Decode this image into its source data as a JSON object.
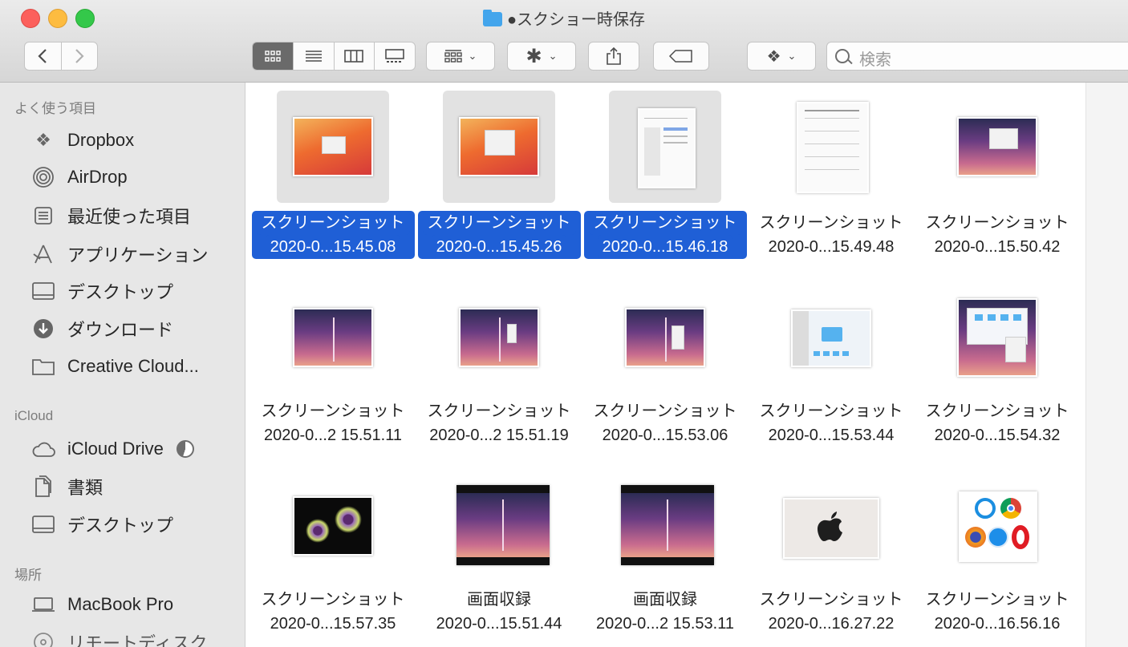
{
  "window": {
    "title": "●スクショー時保存"
  },
  "toolbar": {
    "search_placeholder": "検索"
  },
  "sidebar": {
    "favorites_header": "よく使う項目",
    "favorites": [
      {
        "label": "Dropbox",
        "icon": "dropbox-icon"
      },
      {
        "label": "AirDrop",
        "icon": "airdrop-icon"
      },
      {
        "label": "最近使った項目",
        "icon": "recents-icon"
      },
      {
        "label": "アプリケーション",
        "icon": "applications-icon"
      },
      {
        "label": "デスクトップ",
        "icon": "desktop-icon"
      },
      {
        "label": "ダウンロード",
        "icon": "downloads-icon"
      },
      {
        "label": "Creative Cloud...",
        "icon": "folder-icon"
      }
    ],
    "icloud_header": "iCloud",
    "icloud": [
      {
        "label": "iCloud Drive",
        "icon": "cloud-icon"
      },
      {
        "label": "書類",
        "icon": "documents-icon"
      },
      {
        "label": "デスクトップ",
        "icon": "desktop-icon"
      }
    ],
    "locations_header": "場所",
    "locations": [
      {
        "label": "MacBook Pro",
        "icon": "laptop-icon"
      },
      {
        "label": "リモートディスク",
        "icon": "disc-icon"
      }
    ]
  },
  "files": [
    {
      "name": "スクリーンショット",
      "date": "2020-0...15.45.08",
      "selected": true,
      "thumb": "orange"
    },
    {
      "name": "スクリーンショット",
      "date": "2020-0...15.45.26",
      "selected": true,
      "thumb": "orange"
    },
    {
      "name": "スクリーンショット",
      "date": "2020-0...15.46.18",
      "selected": true,
      "thumb": "doc"
    },
    {
      "name": "スクリーンショット",
      "date": "2020-0...15.49.48",
      "selected": false,
      "thumb": "doc"
    },
    {
      "name": "スクリーンショット",
      "date": "2020-0...15.50.42",
      "selected": false,
      "thumb": "purple"
    },
    {
      "name": "スクリーンショット",
      "date": "2020-0...2 15.51.11",
      "selected": false,
      "thumb": "purple"
    },
    {
      "name": "スクリーンショット",
      "date": "2020-0...2 15.51.19",
      "selected": false,
      "thumb": "purple"
    },
    {
      "name": "スクリーンショット",
      "date": "2020-0...15.53.06",
      "selected": false,
      "thumb": "purple"
    },
    {
      "name": "スクリーンショット",
      "date": "2020-0...15.53.44",
      "selected": false,
      "thumb": "finder"
    },
    {
      "name": "スクリーンショット",
      "date": "2020-0...15.54.32",
      "selected": false,
      "thumb": "purple"
    },
    {
      "name": "スクリーンショット",
      "date": "2020-0...15.57.35",
      "selected": false,
      "thumb": "flower"
    },
    {
      "name": "画面収録",
      "date": "2020-0...15.51.44",
      "selected": false,
      "thumb": "purple"
    },
    {
      "name": "画面収録",
      "date": "2020-0...2 15.53.11",
      "selected": false,
      "thumb": "purple"
    },
    {
      "name": "スクリーンショット",
      "date": "2020-0...16.27.22",
      "selected": false,
      "thumb": "apple"
    },
    {
      "name": "スクリーンショット",
      "date": "2020-0...16.56.16",
      "selected": false,
      "thumb": "browsers"
    }
  ]
}
